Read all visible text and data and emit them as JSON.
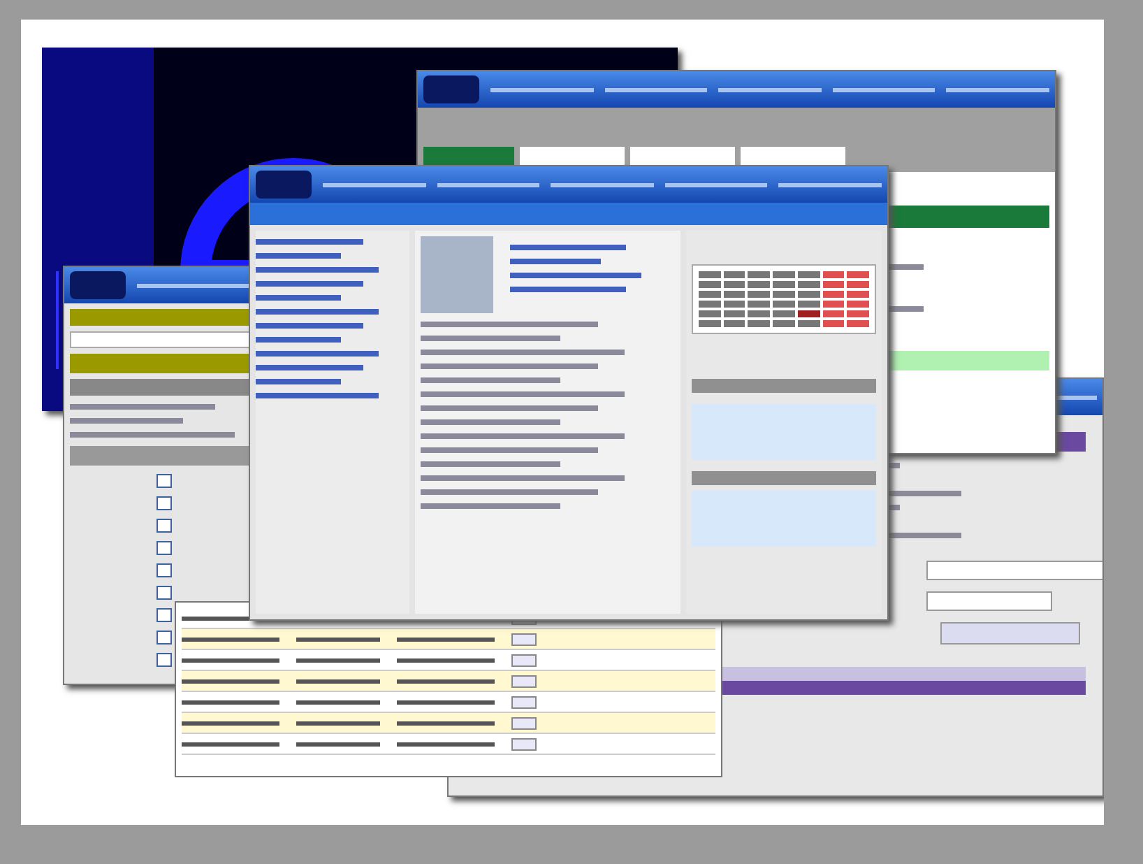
{
  "collage": {
    "windows": [
      {
        "kind": "logo"
      },
      {
        "kind": "records"
      },
      {
        "kind": "tabbed"
      },
      {
        "kind": "form",
        "checkboxes": [
          {
            "checked": false
          },
          {
            "checked": false
          },
          {
            "checked": false
          },
          {
            "checked": false
          },
          {
            "checked": false
          },
          {
            "checked": false
          },
          {
            "checked": false
          },
          {
            "checked": false
          },
          {
            "checked": false
          }
        ]
      },
      {
        "kind": "table"
      },
      {
        "kind": "profile"
      }
    ]
  }
}
